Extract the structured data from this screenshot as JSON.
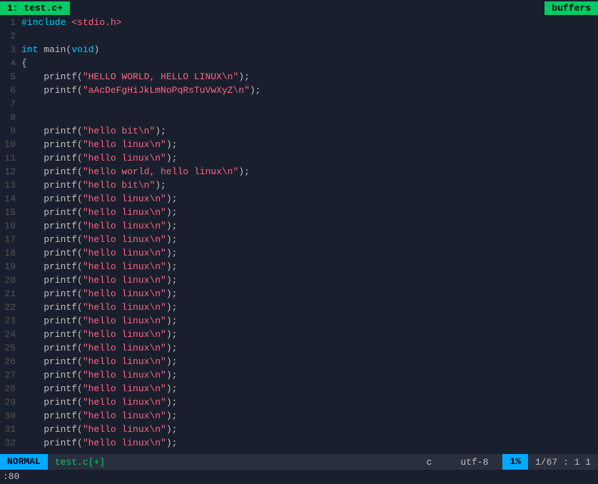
{
  "tab": {
    "label": "1: test.c+",
    "buffers_label": "buffers"
  },
  "status": {
    "mode": "NORMAL",
    "filename": "test.c[+]",
    "filetype": "c",
    "encoding": "utf-8",
    "percent": "1%",
    "position": "1/67 :  1  1"
  },
  "cmdline": ":80",
  "lines": [
    {
      "num": "1",
      "tokens": [
        {
          "t": "include-kw",
          "v": "#include"
        },
        {
          "t": "plain",
          "v": " "
        },
        {
          "t": "include-path",
          "v": "<stdio.h>"
        }
      ]
    },
    {
      "num": "2",
      "tokens": []
    },
    {
      "num": "3",
      "tokens": [
        {
          "t": "kw",
          "v": "int"
        },
        {
          "t": "plain",
          "v": " main("
        },
        {
          "t": "kw",
          "v": "void"
        },
        {
          "t": "plain",
          "v": ")"
        }
      ]
    },
    {
      "num": "4",
      "tokens": [
        {
          "t": "plain",
          "v": "{"
        }
      ]
    },
    {
      "num": "5",
      "tokens": [
        {
          "t": "plain",
          "v": "    printf("
        },
        {
          "t": "str",
          "v": "\"HELLO WORLD, HELLO LINUX\\n\""
        },
        {
          "t": "plain",
          "v": ");"
        }
      ]
    },
    {
      "num": "6",
      "tokens": [
        {
          "t": "plain",
          "v": "    printf("
        },
        {
          "t": "str",
          "v": "\"aAcDeFgHiJkLmNoPqRsTuVwXyZ\\n\""
        },
        {
          "t": "plain",
          "v": ");"
        }
      ]
    },
    {
      "num": "7",
      "tokens": []
    },
    {
      "num": "8",
      "tokens": []
    },
    {
      "num": "9",
      "tokens": [
        {
          "t": "plain",
          "v": "    printf("
        },
        {
          "t": "str",
          "v": "\"hello bit\\n\""
        },
        {
          "t": "plain",
          "v": ");"
        }
      ]
    },
    {
      "num": "10",
      "tokens": [
        {
          "t": "plain",
          "v": "    printf("
        },
        {
          "t": "str",
          "v": "\"hello linux\\n\""
        },
        {
          "t": "plain",
          "v": ");"
        }
      ]
    },
    {
      "num": "11",
      "tokens": [
        {
          "t": "plain",
          "v": "    printf("
        },
        {
          "t": "str",
          "v": "\"hello linux\\n\""
        },
        {
          "t": "plain",
          "v": ");"
        }
      ]
    },
    {
      "num": "12",
      "tokens": [
        {
          "t": "plain",
          "v": "    printf("
        },
        {
          "t": "str",
          "v": "\"hello world, hello linux\\n\""
        },
        {
          "t": "plain",
          "v": ");"
        }
      ]
    },
    {
      "num": "13",
      "tokens": [
        {
          "t": "plain",
          "v": "    printf("
        },
        {
          "t": "str",
          "v": "\"hello bit\\n\""
        },
        {
          "t": "plain",
          "v": ");"
        }
      ]
    },
    {
      "num": "14",
      "tokens": [
        {
          "t": "plain",
          "v": "    printf("
        },
        {
          "t": "str",
          "v": "\"hello linux\\n\""
        },
        {
          "t": "plain",
          "v": ");"
        }
      ]
    },
    {
      "num": "15",
      "tokens": [
        {
          "t": "plain",
          "v": "    printf("
        },
        {
          "t": "str",
          "v": "\"hello linux\\n\""
        },
        {
          "t": "plain",
          "v": ");"
        }
      ]
    },
    {
      "num": "16",
      "tokens": [
        {
          "t": "plain",
          "v": "    printf("
        },
        {
          "t": "str",
          "v": "\"hello linux\\n\""
        },
        {
          "t": "plain",
          "v": ");"
        }
      ]
    },
    {
      "num": "17",
      "tokens": [
        {
          "t": "plain",
          "v": "    printf("
        },
        {
          "t": "str",
          "v": "\"hello linux\\n\""
        },
        {
          "t": "plain",
          "v": ");"
        }
      ]
    },
    {
      "num": "18",
      "tokens": [
        {
          "t": "plain",
          "v": "    printf("
        },
        {
          "t": "str",
          "v": "\"hello linux\\n\""
        },
        {
          "t": "plain",
          "v": ");"
        }
      ]
    },
    {
      "num": "19",
      "tokens": [
        {
          "t": "plain",
          "v": "    printf("
        },
        {
          "t": "str",
          "v": "\"hello linux\\n\""
        },
        {
          "t": "plain",
          "v": ");"
        }
      ]
    },
    {
      "num": "20",
      "tokens": [
        {
          "t": "plain",
          "v": "    printf("
        },
        {
          "t": "str",
          "v": "\"hello linux\\n\""
        },
        {
          "t": "plain",
          "v": ");"
        }
      ]
    },
    {
      "num": "21",
      "tokens": [
        {
          "t": "plain",
          "v": "    printf("
        },
        {
          "t": "str",
          "v": "\"hello linux\\n\""
        },
        {
          "t": "plain",
          "v": ");"
        }
      ]
    },
    {
      "num": "22",
      "tokens": [
        {
          "t": "plain",
          "v": "    printf("
        },
        {
          "t": "str",
          "v": "\"hello linux\\n\""
        },
        {
          "t": "plain",
          "v": ");"
        }
      ]
    },
    {
      "num": "23",
      "tokens": [
        {
          "t": "plain",
          "v": "    printf("
        },
        {
          "t": "str",
          "v": "\"hello linux\\n\""
        },
        {
          "t": "plain",
          "v": ");"
        }
      ]
    },
    {
      "num": "24",
      "tokens": [
        {
          "t": "plain",
          "v": "    printf("
        },
        {
          "t": "str",
          "v": "\"hello linux\\n\""
        },
        {
          "t": "plain",
          "v": ");"
        }
      ]
    },
    {
      "num": "25",
      "tokens": [
        {
          "t": "plain",
          "v": "    printf("
        },
        {
          "t": "str",
          "v": "\"hello linux\\n\""
        },
        {
          "t": "plain",
          "v": ");"
        }
      ]
    },
    {
      "num": "26",
      "tokens": [
        {
          "t": "plain",
          "v": "    printf("
        },
        {
          "t": "str",
          "v": "\"hello linux\\n\""
        },
        {
          "t": "plain",
          "v": ");"
        }
      ]
    },
    {
      "num": "27",
      "tokens": [
        {
          "t": "plain",
          "v": "    printf("
        },
        {
          "t": "str",
          "v": "\"hello linux\\n\""
        },
        {
          "t": "plain",
          "v": ");"
        }
      ]
    },
    {
      "num": "28",
      "tokens": [
        {
          "t": "plain",
          "v": "    printf("
        },
        {
          "t": "str",
          "v": "\"hello linux\\n\""
        },
        {
          "t": "plain",
          "v": ");"
        }
      ]
    },
    {
      "num": "29",
      "tokens": [
        {
          "t": "plain",
          "v": "    printf("
        },
        {
          "t": "str",
          "v": "\"hello linux\\n\""
        },
        {
          "t": "plain",
          "v": ");"
        }
      ]
    },
    {
      "num": "30",
      "tokens": [
        {
          "t": "plain",
          "v": "    printf("
        },
        {
          "t": "str",
          "v": "\"hello linux\\n\""
        },
        {
          "t": "plain",
          "v": ");"
        }
      ]
    },
    {
      "num": "31",
      "tokens": [
        {
          "t": "plain",
          "v": "    printf("
        },
        {
          "t": "str",
          "v": "\"hello linux\\n\""
        },
        {
          "t": "plain",
          "v": ");"
        }
      ]
    },
    {
      "num": "32",
      "tokens": [
        {
          "t": "plain",
          "v": "    printf("
        },
        {
          "t": "str",
          "v": "\"hello linux\\n\""
        },
        {
          "t": "plain",
          "v": ");"
        }
      ]
    }
  ]
}
